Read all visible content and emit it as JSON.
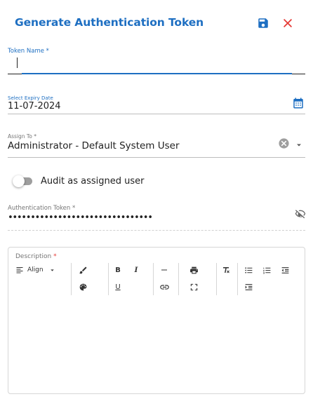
{
  "dialog": {
    "title": "Generate Authentication Token"
  },
  "token_name": {
    "label": "Token Name *",
    "value": ""
  },
  "expiry": {
    "label": "Select Expiry Date",
    "value": "11-07-2024"
  },
  "assign_to": {
    "label": "Assign To *",
    "value": "Administrator - Default System User"
  },
  "audit": {
    "label": "Audit as assigned user",
    "enabled": false
  },
  "auth_token": {
    "label": "Authentication Token *",
    "value": "••••••••••••••••••••••••••••••••"
  },
  "description": {
    "label": "Description",
    "required_mark": "*",
    "toolbar": {
      "align_label": "Align",
      "bold": "B",
      "italic": "I",
      "underline": "U"
    }
  },
  "colors": {
    "accent": "#1e6fc2",
    "close": "#e53935"
  }
}
